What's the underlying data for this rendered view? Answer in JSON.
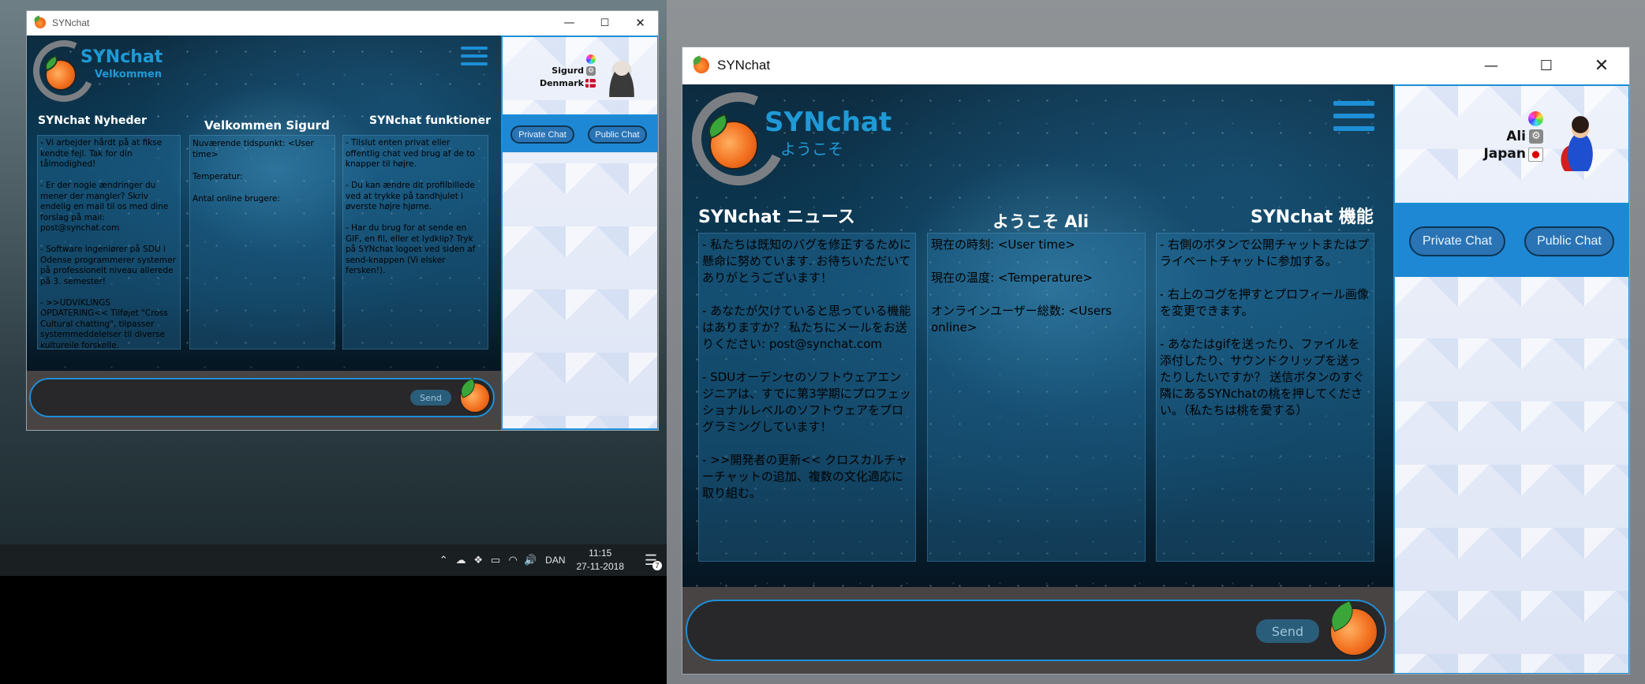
{
  "taskbar": {
    "language": "DAN",
    "time": "11:15",
    "date": "27-11-2018",
    "notifications_count": "7",
    "tray_icons": [
      "chevron-up-icon",
      "onedrive-cloud-icon",
      "dropbox-icon",
      "network-icon",
      "wifi-icon",
      "volume-icon"
    ]
  },
  "win1": {
    "title": "SYNchat",
    "brand": "SYNchat",
    "subtitle": "Velkommen",
    "col1_head": "SYNchat Nyheder",
    "col2_head": "Velkommen Sigurd",
    "col3_head": "SYNchat funktioner",
    "col1_text": "- Vi arbejder hårdt på at fikse kendte fejl. Tak for din tålmodighed!\n\n- Er der nogle ændringer du mener der mangler? Skriv endelig en mail til os med dine forslag på mail: post@synchat.com\n\n- Software ingeniører på SDU i Odense programmerer systemer på professionelt niveau allerede på 3. semester!\n\n- >>UDVIKLINGS OPDATERING<< Tilføjet \"Cross Cultural chatting\", tilpasser systemmeddelelser til diverse kulturelle forskelle.",
    "col2_text": "Nuværende tidspunkt: <User time>\n\nTemperatur:\n\nAntal online brugere:",
    "col3_text": "- Tilslut enten privat eller offentlig chat ved brug af de to knapper til højre.\n\n- Du kan ændre dit profilbillede ved at trykke på tandhjulet i øverste højre hjørne.\n\n- Har du brug for at sende en GIF, en fil, eller et lydklip? Tryk på SYNchat logoet ved siden af send-knappen (Vi elsker fersken!).",
    "send_label": "Send",
    "profile_name": "Sigurd",
    "profile_country": "Denmark",
    "private_chat": "Private Chat",
    "public_chat": "Public Chat"
  },
  "win2": {
    "title": "SYNchat",
    "brand": "SYNchat",
    "subtitle": "ようこそ",
    "col1_head": "SYNchat ニュース",
    "col2_head": "ようこそ Ali",
    "col3_head": "SYNchat 機能",
    "col1_text": "- 私たちは既知のバグを修正するために懸命に努めています. お待ちいただいてありがとうございます！\n\n- あなたが欠けていると思っている機能はありますか？ 私たちにメールをお送りください: post@synchat.com\n\n- SDUオーデンセのソフトウェアエンジニアは、すでに第3学期にプロフェッショナルレベルのソフトウェアをプログラミングしています！\n\n- >>開発者の更新<< クロスカルチャーチャットの追加、複数の文化適応に取り組む。",
    "col2_text": "現在の時刻: <User time>\n\n現在の温度: <Temperature>\n\nオンラインユーザー総数: <Users online>",
    "col3_text": "- 右側のボタンで公開チャットまたはプライベートチャットに参加する。\n\n- 右上のコグを押すとプロフィール画像を変更できます。\n\n- あなたはgifを送ったり、ファイルを添付したり、サウンドクリップを送ったりしたいですか？ 送信ボタンのすぐ隣にあるSYNchatの桃を押してください。（私たちは桃を愛する）",
    "send_label": "Send",
    "profile_name": "Ali",
    "profile_country": "Japan",
    "private_chat": "Private Chat",
    "public_chat": "Public Chat"
  },
  "colors": {
    "accent": "#1c8fd6",
    "brand_blue": "#1f9ad6",
    "panel_bg": "#eef2fb"
  }
}
